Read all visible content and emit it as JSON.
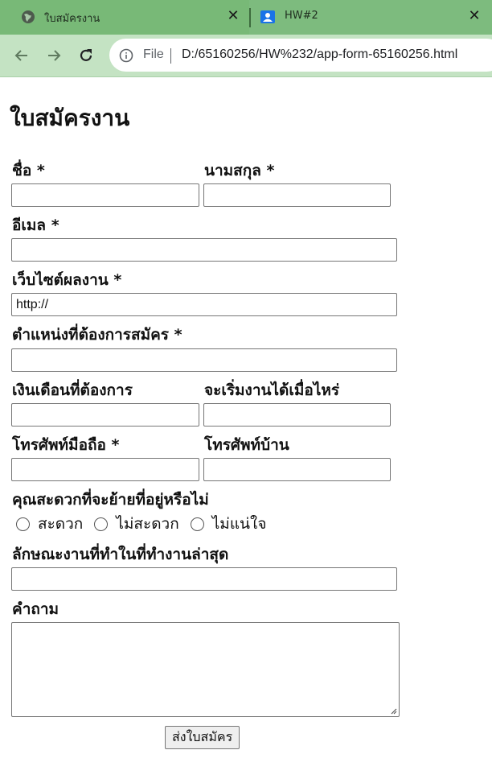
{
  "browser": {
    "tabs": [
      {
        "title": "ใบสมัครงาน",
        "icon": "globe-icon",
        "active": true
      },
      {
        "title": "HW#2",
        "icon": "contact-icon",
        "active": false
      }
    ],
    "close_glyph": "✕",
    "omnibox": {
      "scheme_label": "File",
      "url": "D:/65160256/HW%232/app-form-65160256.html"
    }
  },
  "form": {
    "title": "ใบสมัครงาน",
    "fields": {
      "first_name": {
        "label": "ชื่อ *",
        "value": ""
      },
      "last_name": {
        "label": "นามสกุล *",
        "value": ""
      },
      "email": {
        "label": "อีเมล *",
        "value": ""
      },
      "portfolio_site": {
        "label": "เว็บไซต์ผลงาน *",
        "value": "http://"
      },
      "position": {
        "label": "ตำแหน่งที่ต้องการสมัคร *",
        "value": ""
      },
      "salary": {
        "label": "เงินเดือนที่ต้องการ",
        "value": ""
      },
      "start_date": {
        "label": "จะเริ่มงานได้เมื่อไหร่",
        "value": ""
      },
      "mobile_phone": {
        "label": "โทรศัพท์มือถือ *",
        "value": ""
      },
      "home_phone": {
        "label": "โทรศัพท์บ้าน",
        "value": ""
      },
      "relocate": {
        "label": "คุณสะดวกที่จะย้ายที่อยู่หรือไม่",
        "options": [
          "สะดวก",
          "ไม่สะดวก",
          "ไม่แน่ใจ"
        ],
        "selected": null
      },
      "last_job": {
        "label": "ลักษณะงานที่ทำในที่ทำงานล่าสุด",
        "value": ""
      },
      "question": {
        "label": "คำถาม",
        "value": ""
      }
    },
    "submit_label": "ส่งใบสมัคร"
  },
  "colors": {
    "tabstrip": "#7dbb7e",
    "toolbar": "#c4e3c3",
    "page_background": "#ffffff"
  }
}
